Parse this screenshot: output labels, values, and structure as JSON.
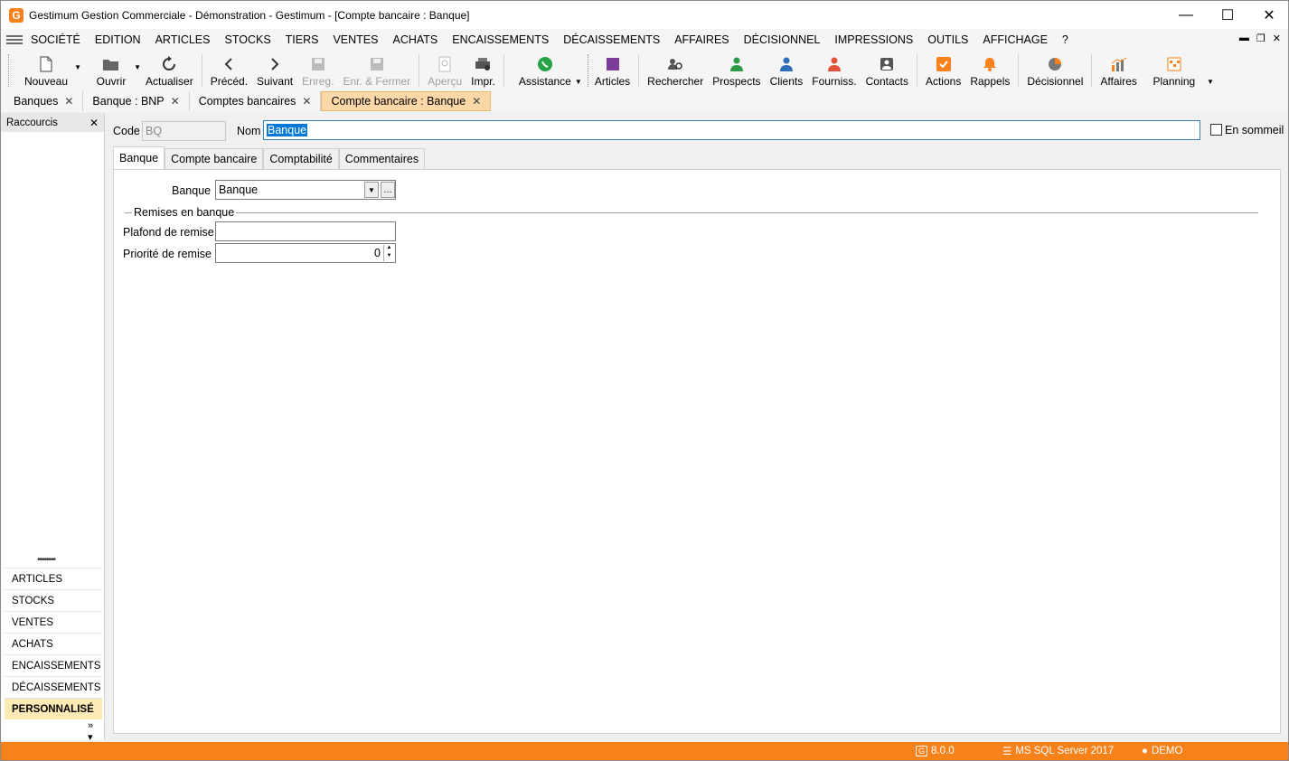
{
  "window": {
    "title": "Gestimum Gestion Commerciale - Démonstration - Gestimum - [Compte bancaire : Banque]",
    "logo_letter": "G"
  },
  "menu": [
    "SOCIÉTÉ",
    "EDITION",
    "ARTICLES",
    "STOCKS",
    "TIERS",
    "VENTES",
    "ACHATS",
    "ENCAISSEMENTS",
    "DÉCAISSEMENTS",
    "AFFAIRES",
    "DÉCISIONNEL",
    "IMPRESSIONS",
    "OUTILS",
    "AFFICHAGE",
    "?"
  ],
  "toolbar": {
    "nouveau": "Nouveau",
    "ouvrir": "Ouvrir",
    "actualiser": "Actualiser",
    "preced": "Précéd.",
    "suivant": "Suivant",
    "enreg": "Enreg.",
    "enr_fermer": "Enr. & Fermer",
    "apercu": "Aperçu",
    "impr": "Impr.",
    "assistance": "Assistance",
    "articles": "Articles",
    "rechercher": "Rechercher",
    "prospects": "Prospects",
    "clients": "Clients",
    "fourniss": "Fourniss.",
    "contacts": "Contacts",
    "actions": "Actions",
    "rappels": "Rappels",
    "decisionnel": "Décisionnel",
    "affaires": "Affaires",
    "planning": "Planning"
  },
  "doc_tabs": [
    "Banques",
    "Banque : BNP",
    "Comptes bancaires",
    "Compte bancaire : Banque"
  ],
  "shortcuts": {
    "title": "Raccourcis",
    "items": [
      "ARTICLES",
      "STOCKS",
      "VENTES",
      "ACHATS",
      "ENCAISSEMENTS",
      "DÉCAISSEMENTS",
      "PERSONNALISÉ"
    ]
  },
  "form": {
    "code_label": "Code",
    "code_value": "BQ",
    "nom_label": "Nom",
    "nom_value": "Banque",
    "sleep_label": "En sommeil",
    "tabs": [
      "Banque",
      "Compte bancaire",
      "Comptabilité",
      "Commentaires"
    ],
    "banque_label": "Banque",
    "banque_value": "Banque",
    "group_label": "Remises en banque",
    "plafond_label": "Plafond de remise",
    "plafond_value": "",
    "priorite_label": "Priorité de remise",
    "priorite_value": "0"
  },
  "status": {
    "version": "8.0.0",
    "server": "MS SQL Server 2017",
    "user": "DEMO"
  },
  "colors": {
    "accent": "#f7821b",
    "active_tab": "#fcd8a8",
    "selected_shortcut": "#fdeab4"
  }
}
